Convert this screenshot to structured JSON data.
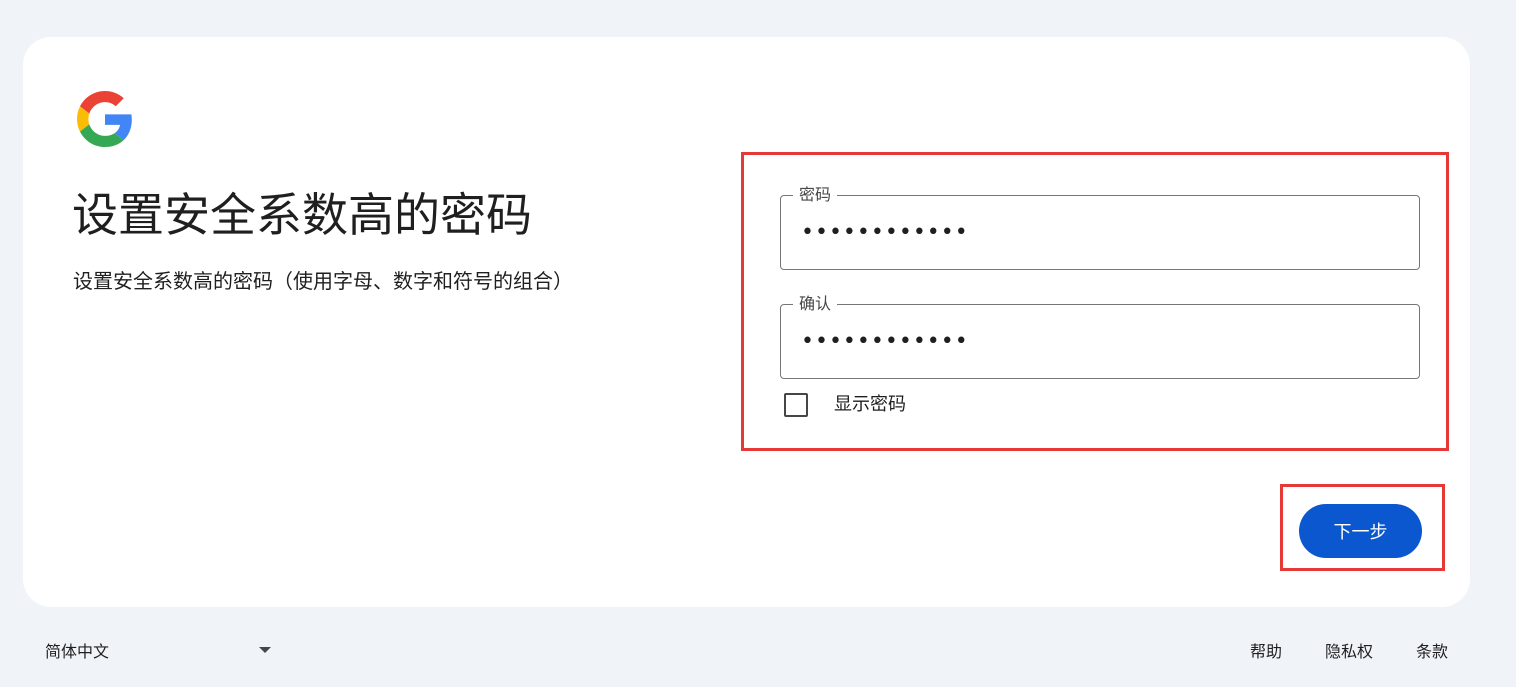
{
  "brand": {
    "logo_icon": "google-g-logo",
    "colors": {
      "blue": "#4285F4",
      "red": "#EA4335",
      "yellow": "#FBBC05",
      "green": "#34A853"
    }
  },
  "header": {
    "title": "设置安全系数高的密码",
    "subtitle": "设置安全系数高的密码（使用字母、数字和符号的组合）"
  },
  "form": {
    "password": {
      "label": "密码",
      "value": "••••••••••••"
    },
    "confirm": {
      "label": "确认",
      "value": "••••••••••••"
    },
    "show_password": {
      "label": "显示密码",
      "checked": false
    }
  },
  "actions": {
    "next_label": "下一步",
    "accent": "#0b57d0"
  },
  "highlight_color": "#e53935",
  "footer": {
    "language": "简体中文",
    "links": {
      "help": "帮助",
      "privacy": "隐私权",
      "terms": "条款"
    }
  }
}
